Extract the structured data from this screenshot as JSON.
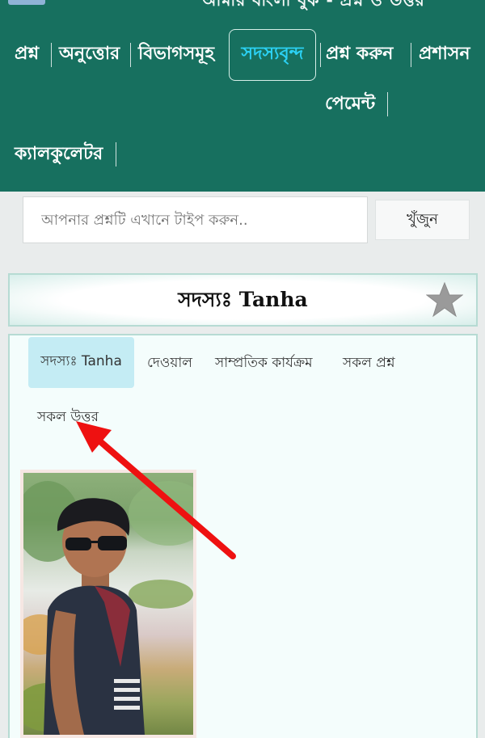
{
  "header": {
    "site_title": "আমার বাংলা বুক - প্রশ্ন ও উত্তর"
  },
  "nav": {
    "items": [
      {
        "label": "প্রশ্ন"
      },
      {
        "label": "অনুত্তোর"
      },
      {
        "label": "বিভাগসমূহ"
      },
      {
        "label": "সদস্যবৃন্দ",
        "active": true
      },
      {
        "label": "প্রশ্ন করুন"
      },
      {
        "label": "প্রশাসন"
      },
      {
        "label": "পেমেন্ট"
      },
      {
        "label": "ক্যালকুলেটর"
      }
    ]
  },
  "search": {
    "placeholder": "আপনার প্রশ্নটি এখানে টাইপ করুন..",
    "button_label": "খুঁজুন"
  },
  "member": {
    "title": "সদস্যঃ Tanha",
    "favorite_icon": "star-icon"
  },
  "tabs": [
    {
      "label": "সদস্যঃ Tanha",
      "active": true
    },
    {
      "label": "দেওয়াল"
    },
    {
      "label": "সাম্প্রতিক কার্যক্রম"
    },
    {
      "label": "সকল প্রশ্ন"
    },
    {
      "label": "সকল উত্তর"
    }
  ],
  "colors": {
    "header_bg": "#17705f",
    "active_nav_text": "#2bd1f4",
    "active_tab_bg": "#c4ecf4",
    "annotation_arrow": "#ee1111"
  },
  "avatar": {
    "description_icon": "profile-photo"
  }
}
